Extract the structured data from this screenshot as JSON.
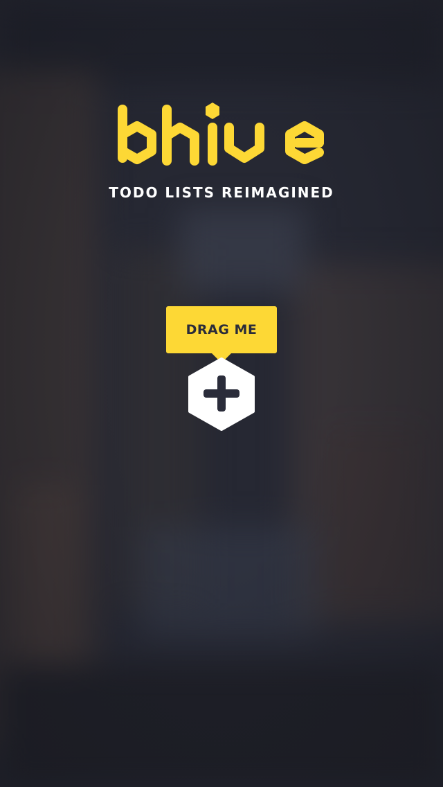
{
  "app": {
    "name": "bhive",
    "tagline": "TODO LISTS REIMAGINED"
  },
  "hint": {
    "label": "DRAG ME"
  },
  "add_button": {
    "icon": "plus-icon"
  },
  "colors": {
    "accent": "#fdd835",
    "dark": "#2a2c3a",
    "white": "#ffffff"
  }
}
